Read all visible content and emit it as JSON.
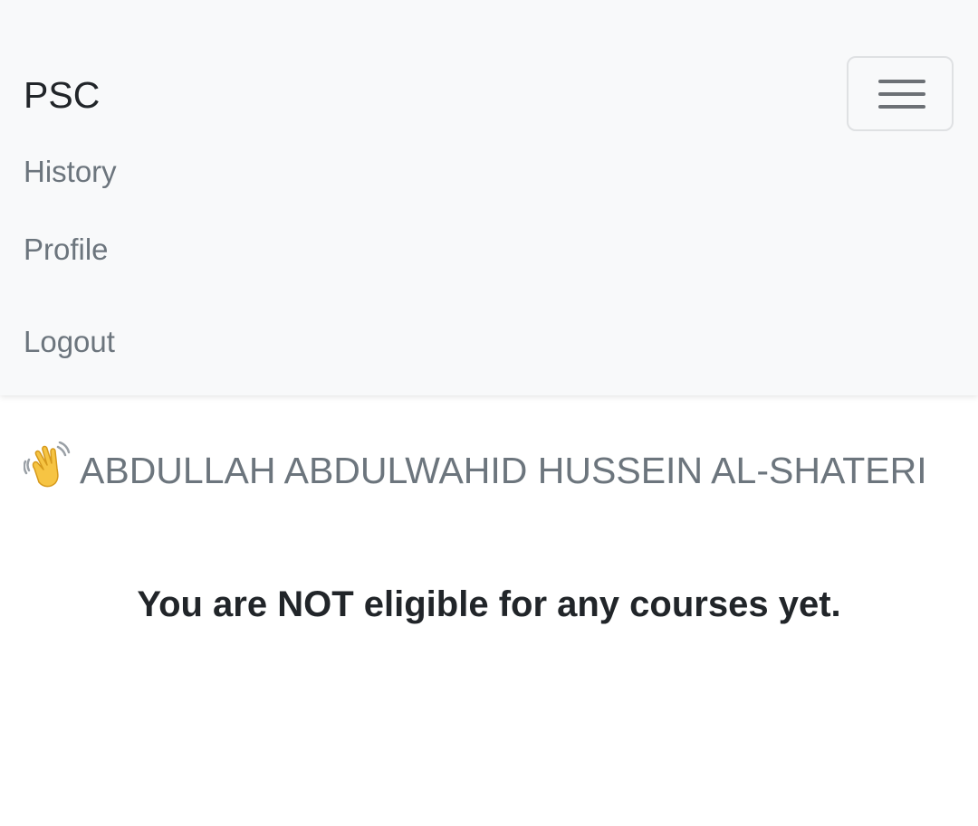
{
  "navbar": {
    "brand": "PSC",
    "toggler_icon": "hamburger-menu-icon",
    "links": [
      {
        "label": "History"
      },
      {
        "label": "Profile"
      },
      {
        "label": "Logout"
      }
    ]
  },
  "main": {
    "greeting_icon": "waving-hand-icon",
    "user_name": "ABDULLAH ABDULWAHID HUSSEIN AL-SHATERI",
    "eligibility_message": "You are NOT eligible for any courses yet."
  },
  "colors": {
    "navbar_background": "#f8f9fa",
    "brand_text": "#212529",
    "link_text": "#6c757d",
    "body_text": "#212529"
  }
}
